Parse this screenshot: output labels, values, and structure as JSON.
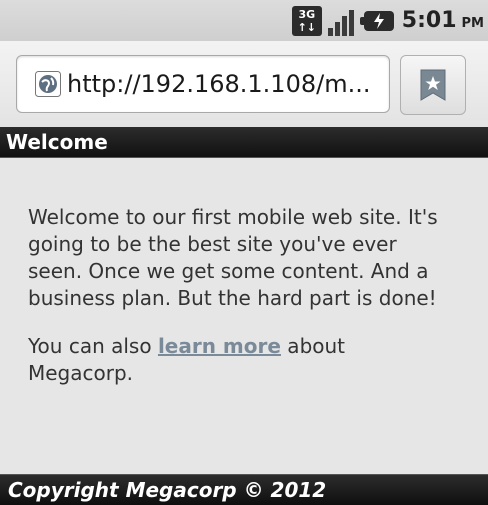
{
  "status_bar": {
    "network_label_top": "3G",
    "network_label_bottom": "↑↓",
    "time": "5:01",
    "ampm": "PM",
    "icons": [
      "network-3g-icon",
      "signal-strength-icon",
      "battery-charging-icon"
    ]
  },
  "browser": {
    "url": "http://192.168.1.108/m...",
    "icons": [
      "globe-icon",
      "bookmark-star-icon"
    ]
  },
  "header": {
    "title": "Welcome"
  },
  "content": {
    "paragraph1": "Welcome to our first mobile web site. It's going to be the best site you've ever seen. Once we get some content. And a business plan. But the hard part is done!",
    "paragraph2_before": "You can also ",
    "paragraph2_link": "learn more",
    "paragraph2_after": " about Megacorp."
  },
  "footer": {
    "text": "Copyright Megacorp © 2012"
  },
  "colors": {
    "background": "#e6e6e6",
    "header_bg": "#1e1e1e",
    "link": "#7b8a99",
    "text": "#333333"
  }
}
